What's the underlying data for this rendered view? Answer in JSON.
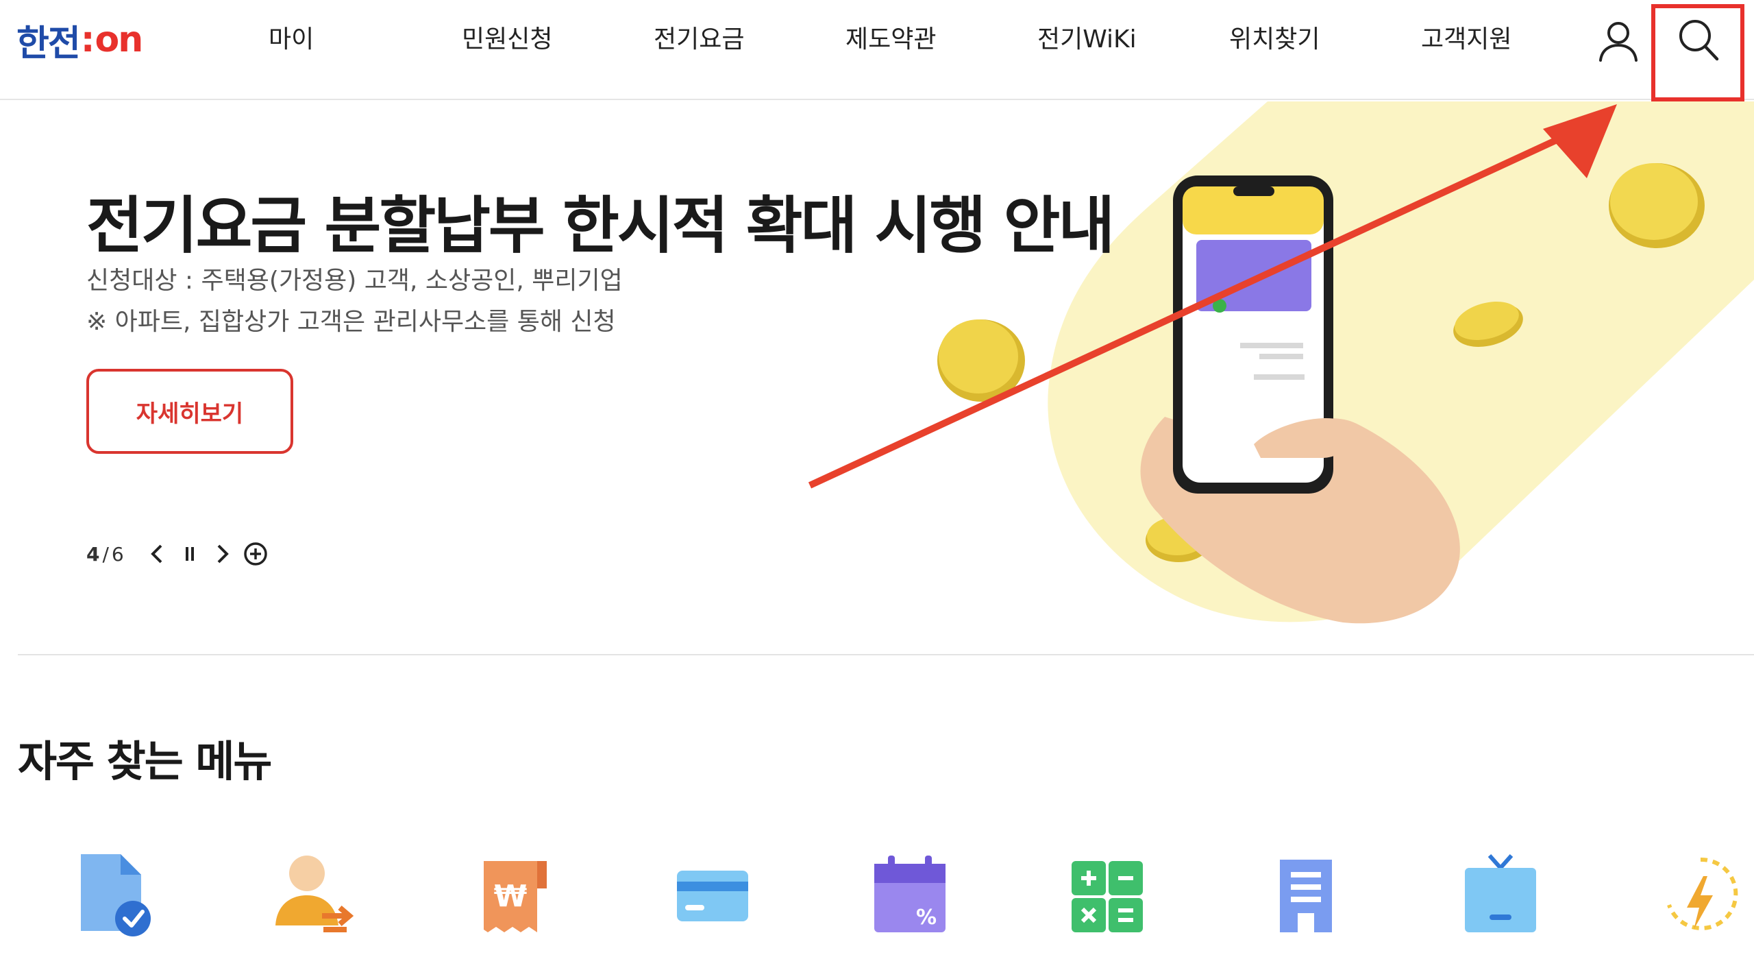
{
  "header": {
    "logo": {
      "part1": "한전",
      "colon": ":",
      "part2": "on"
    },
    "nav": [
      "마이",
      "민원신청",
      "전기요금",
      "제도약관",
      "전기WiKi",
      "위치찾기",
      "고객지원"
    ],
    "icons": {
      "user": "user-icon",
      "search": "search-icon"
    }
  },
  "hero": {
    "title": "전기요금 분할납부 한시적 확대 시행 안내",
    "subtitle1": "신청대상 : 주택용(가정용) 고객, 소상공인, 뿌리기업",
    "subtitle2": "※ 아파트, 집합상가 고객은 관리사무소를 통해 신청",
    "detail_button": "자세히보기",
    "pager": {
      "current": "4",
      "separator": "/",
      "total": "6"
    }
  },
  "frequent": {
    "title": "자주 찾는 메뉴",
    "icons": [
      "document-check-icon",
      "user-transfer-icon",
      "won-receipt-icon",
      "credit-card-icon",
      "calendar-percent-icon",
      "calculator-icon",
      "building-icon",
      "tv-icon",
      "lightning-refresh-icon"
    ]
  },
  "colors": {
    "brand_blue": "#1f4ba8",
    "brand_red": "#e8312c",
    "annotation_red": "#e8412c",
    "hero_yellow": "#fbf4c4"
  }
}
